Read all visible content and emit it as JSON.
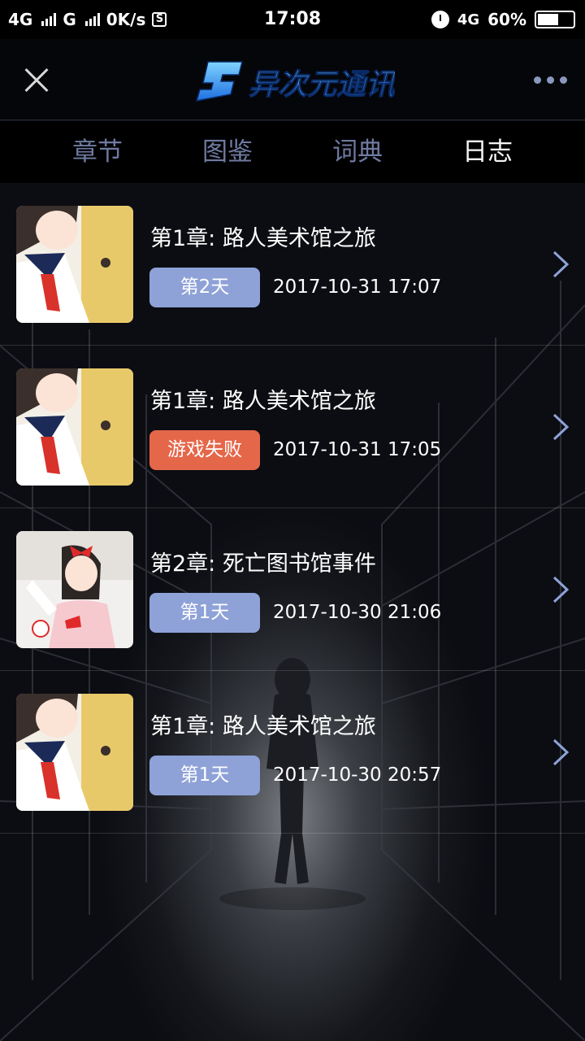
{
  "status_bar": {
    "network1": "4G",
    "network2": "G",
    "speed": "0K/s",
    "s_icon": "S",
    "time": "17:08",
    "network3": "4G",
    "battery": "60%",
    "battery_level": 0.6
  },
  "header": {
    "logo_text": "异次元通讯",
    "close_icon": "close-icon",
    "more_icon": "more-icon"
  },
  "tabs": [
    "章节",
    "图鉴",
    "词典",
    "日志"
  ],
  "active_tab": 3,
  "log_entries": [
    {
      "title": "第1章: 路人美术馆之旅",
      "badge": "第2天",
      "badge_type": "day",
      "date": "2017-10-31 17:07",
      "thumb": "schoolgirl-with-mascot"
    },
    {
      "title": "第1章: 路人美术馆之旅",
      "badge": "游戏失败",
      "badge_type": "fail",
      "date": "2017-10-31 17:05",
      "thumb": "schoolgirl-with-mascot"
    },
    {
      "title": "第2章: 死亡图书馆事件",
      "badge": "第1天",
      "badge_type": "day",
      "date": "2017-10-30 21:06",
      "thumb": "girl-with-red-bow"
    },
    {
      "title": "第1章: 路人美术馆之旅",
      "badge": "第1天",
      "badge_type": "day",
      "date": "2017-10-30 20:57",
      "thumb": "schoolgirl-with-mascot"
    }
  ],
  "colors": {
    "day_badge": "#8ea2d8",
    "fail_badge": "#e5674a",
    "tab_inactive": "#6f7aa1",
    "logo_blue": "#2f86ff"
  }
}
